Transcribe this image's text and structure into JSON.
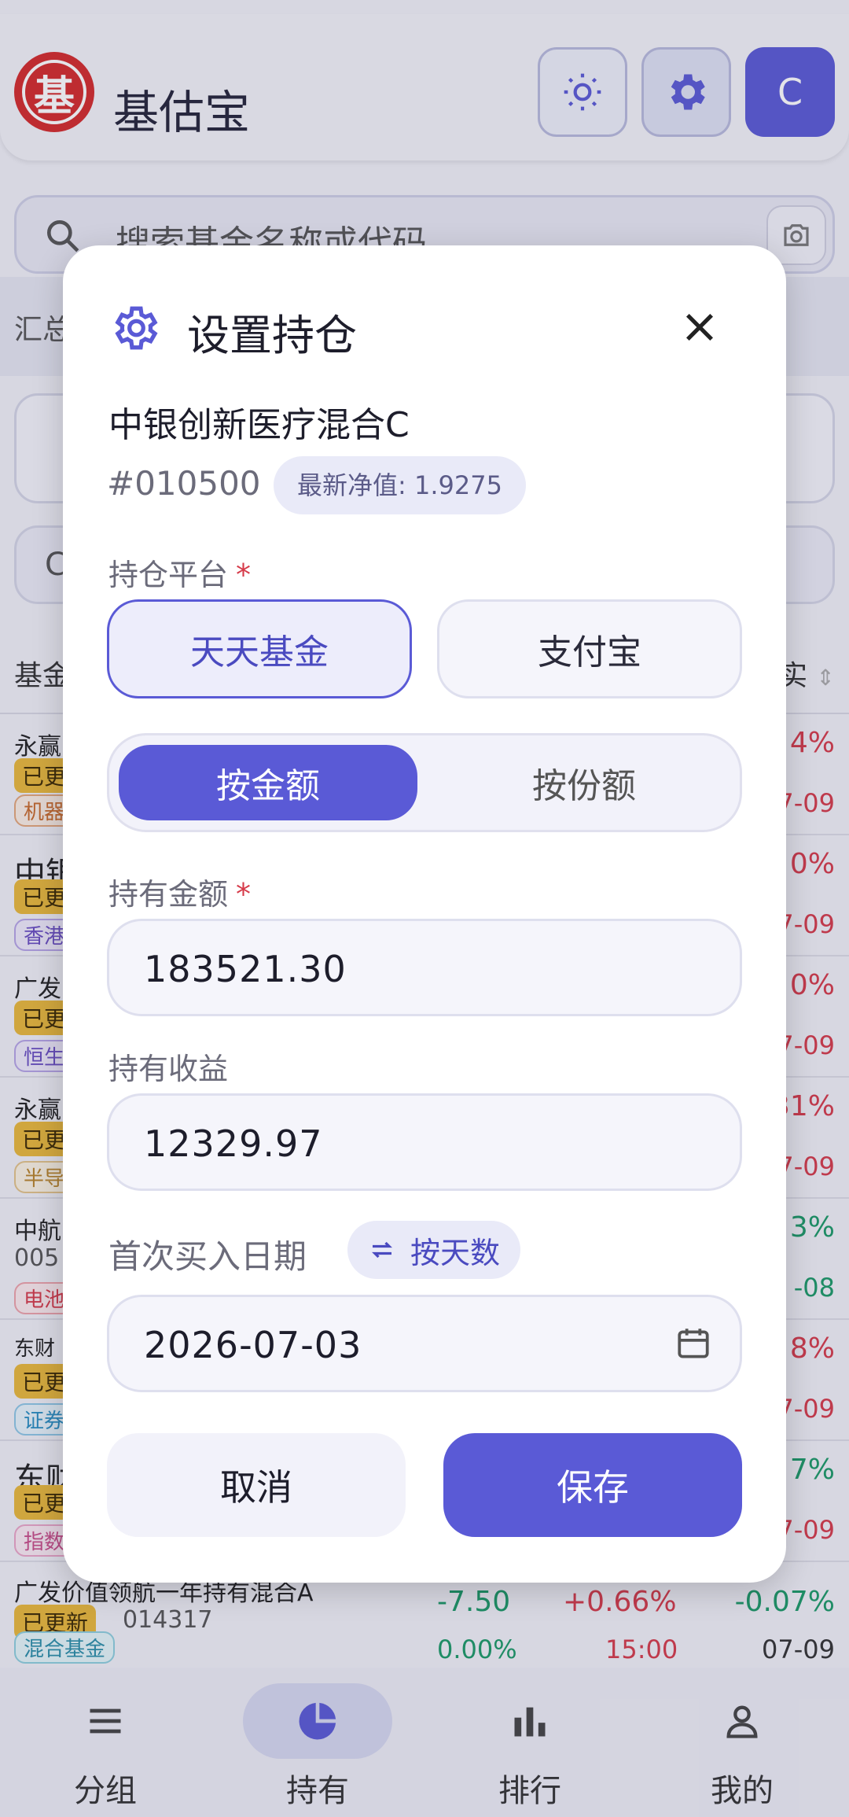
{
  "app": {
    "title": "基估宝",
    "logo_char": "基",
    "avatar_letter": "C"
  },
  "search": {
    "placeholder": "搜索基金名称或代码"
  },
  "summary": {
    "label": "汇总"
  },
  "list": {
    "header_left": "基金",
    "header_right": "实",
    "rows": [
      {
        "name": "永赢",
        "badge": "已更",
        "tag": "机器",
        "v1": "4%",
        "v2": "07-09"
      },
      {
        "name": "中银",
        "badge": "已更",
        "tag": "香港",
        "v1": "0%",
        "v2": "7-09"
      },
      {
        "name": "广发",
        "badge": "已更",
        "tag": "恒生",
        "v1": "0%",
        "v2": "7-09"
      },
      {
        "name": "永赢",
        "badge": "已更",
        "tag": "半导",
        "v1": "31%",
        "v2": "7-09"
      },
      {
        "name": "中航",
        "code": "005",
        "tag": "电池",
        "v1": "3%",
        "v2": "-08"
      },
      {
        "name": "东财",
        "badge": "已更",
        "tag": "证券",
        "v1": "8%",
        "v2": "7-09"
      },
      {
        "name": "东财",
        "badge": "已更",
        "tag": "指数",
        "v1": "7%",
        "v2": "7-09"
      },
      {
        "name": "广发价值领航一年持有混合A",
        "badge": "已更新",
        "code": "014317",
        "tag": "混合基金",
        "m1": "-7.50",
        "m2": "+0.66%",
        "v1": "-0.07%",
        "m3": "0.00%",
        "m4": "15:00",
        "v2": "07-09"
      }
    ]
  },
  "bottom_nav": [
    {
      "label": "分组",
      "icon": "menu-icon"
    },
    {
      "label": "持有",
      "icon": "pie-chart-icon",
      "active": true
    },
    {
      "label": "排行",
      "icon": "bar-chart-icon"
    },
    {
      "label": "我的",
      "icon": "user-icon"
    }
  ],
  "modal": {
    "title": "设置持仓",
    "fund_name": "中银创新医疗混合C",
    "fund_code": "#010500",
    "latest_nav": "最新净值: 1.9275",
    "platform_label": "持仓平台",
    "required_mark": "*",
    "platforms": [
      "天天基金",
      "支付宝"
    ],
    "selected_platform": "天天基金",
    "mode_options": [
      "按金额",
      "按份额"
    ],
    "selected_mode": "按金额",
    "amount_label": "持有金额",
    "amount_value": "183521.30",
    "profit_label": "持有收益",
    "profit_value": "12329.97",
    "date_label": "首次买入日期",
    "days_toggle": "按天数",
    "date_value": "2026-07-03",
    "cancel": "取消",
    "save": "保存"
  },
  "colors": {
    "accent": "#5a5ad6",
    "up": "#d63b4a",
    "down": "#1b9a67",
    "badge": "#e9b83a"
  }
}
